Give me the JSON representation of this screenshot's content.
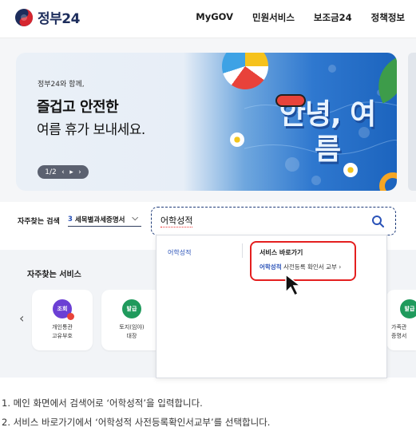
{
  "header": {
    "logo_text": "정부24",
    "nav": [
      "MyGOV",
      "민원서비스",
      "보조금24",
      "정책정보"
    ]
  },
  "banner": {
    "small_text": "정부24와 함께,",
    "headline": "즐겁고 안전한",
    "subline": "여름 휴가 보내세요.",
    "page_indicator": "1/2",
    "prev_symbol": "‹",
    "play_symbol": "▸",
    "next_symbol": "›",
    "artwork_text": "안녕, 여름"
  },
  "search": {
    "frequent_label": "자주찾는 검색",
    "frequent_num": "3",
    "frequent_value": "세목별과세증명서",
    "input_value": "어학성적"
  },
  "services": {
    "title": "자주찾는 서비스",
    "cards": [
      {
        "badge": "조회",
        "label_1": "개인통관",
        "label_2": "고유부호",
        "color": "#6b3fd4"
      },
      {
        "badge": "발급",
        "label_1": "토지(임야)",
        "label_2": "대장",
        "color": "#1f9a5c"
      },
      {
        "badge": "발급",
        "label_1": "가족관",
        "label_2": "증명서",
        "color": "#1f9a5c"
      }
    ]
  },
  "dropdown": {
    "suggestion": "어학성적",
    "shortcut_title": "서비스 바로가기",
    "shortcut_highlight": "어학성적",
    "shortcut_rest": " 사전등록 확인서 교부  ›"
  },
  "instructions": [
    "1. 메인 화면에서 검색어로 ‘어학성적’을 입력합니다.",
    "2. 서비스 바로가기에서 ‘어학성적 사전등록확인서교부’를 선택합니다."
  ]
}
